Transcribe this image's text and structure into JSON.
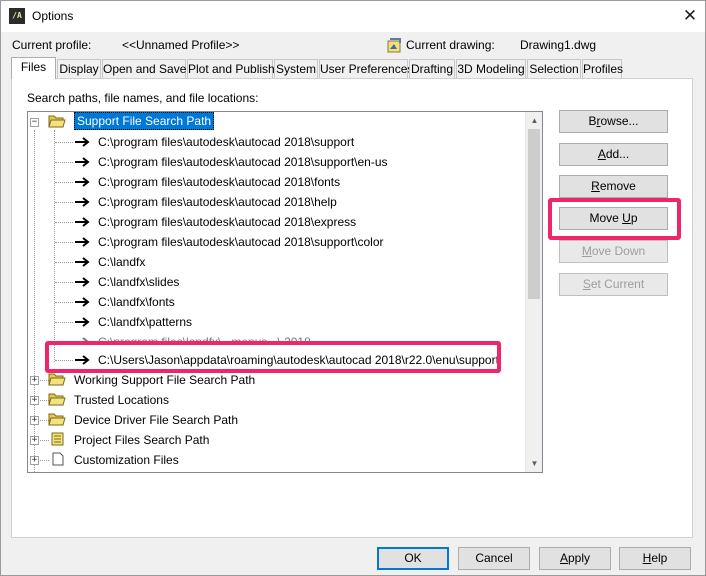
{
  "window": {
    "title": "Options",
    "icon_text": "/A",
    "close_glyph": "✕"
  },
  "profile": {
    "current_profile_label": "Current profile:",
    "current_profile_value": "<<Unnamed Profile>>",
    "current_drawing_label": "Current drawing:",
    "current_drawing_value": "Drawing1.dwg"
  },
  "tabs": [
    {
      "label": "Files",
      "active": true
    },
    {
      "label": "Display"
    },
    {
      "label": "Open and Save"
    },
    {
      "label": "Plot and Publish"
    },
    {
      "label": "System"
    },
    {
      "label": "User Preferences"
    },
    {
      "label": "Drafting"
    },
    {
      "label": "3D Modeling"
    },
    {
      "label": "Selection"
    },
    {
      "label": "Profiles"
    }
  ],
  "files": {
    "section_label": "Search paths, file names, and file locations:",
    "tree": {
      "support_root": "Support File Search Path",
      "paths": [
        "C:\\program files\\autodesk\\autocad 2018\\support",
        "C:\\program files\\autodesk\\autocad 2018\\support\\en-us",
        "C:\\program files\\autodesk\\autocad 2018\\fonts",
        "C:\\program files\\autodesk\\autocad 2018\\help",
        "C:\\program files\\autodesk\\autocad 2018\\express",
        "C:\\program files\\autodesk\\autocad 2018\\support\\color",
        "C:\\landfx",
        "C:\\landfx\\slides",
        "C:\\landfx\\fonts",
        "C:\\landfx\\patterns",
        "C:\\program files\\landfx\\...menus...\\ 2018",
        "C:\\Users\\Jason\\appdata\\roaming\\autodesk\\autocad 2018\\r22.0\\enu\\support"
      ],
      "other_nodes": [
        "Working Support File Search Path",
        "Trusted Locations",
        "Device Driver File Search Path",
        "Project Files Search Path",
        "Customization Files"
      ]
    }
  },
  "side_buttons": {
    "browse_pre": "B",
    "browse_ul": "r",
    "browse_post": "owse...",
    "add_pre": "",
    "add_ul": "A",
    "add_post": "dd...",
    "remove_pre": "",
    "remove_ul": "R",
    "remove_post": "emove",
    "move_up_pre": "Move ",
    "move_up_ul": "U",
    "move_up_post": "p",
    "move_down_pre": "",
    "move_down_ul": "M",
    "move_down_post": "ove Down",
    "set_current_pre": "",
    "set_current_ul": "S",
    "set_current_post": "et Current"
  },
  "footer": {
    "ok": "OK",
    "cancel": "Cancel",
    "apply_ul": "A",
    "apply_post": "pply",
    "help_ul": "H",
    "help_post": "elp"
  },
  "colors": {
    "highlight": "#f0256a",
    "selection": "#0078d7"
  }
}
